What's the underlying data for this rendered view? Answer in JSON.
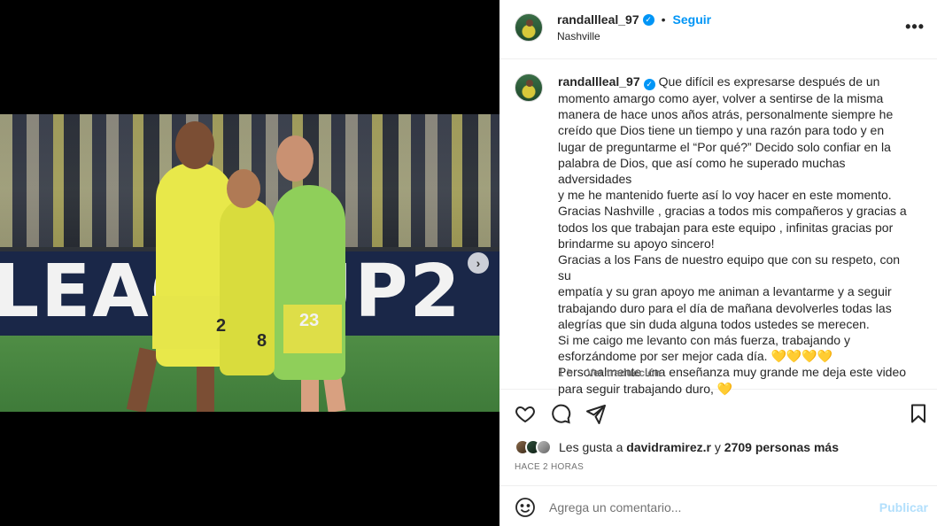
{
  "media": {
    "board_text": "LEAG  CUP2",
    "jersey_numbers": [
      "2",
      "8",
      "23"
    ],
    "next_glyph": "›",
    "carousel": {
      "count": 2,
      "active": 0
    }
  },
  "header": {
    "username": "randallleal_97",
    "verified_glyph": "✓",
    "separator": "•",
    "follow_label": "Seguir",
    "location": "Nashville",
    "more_glyph": "•••"
  },
  "caption": {
    "username": "randallleal_97",
    "lines": [
      "Que difícil es expresarse después de un",
      "momento amargo como ayer, volver a sentirse de la misma",
      "manera de hace unos años atrás, personalmente siempre he",
      "creído que Dios tiene un tiempo y una razón para todo y en",
      "lugar de preguntarme el “Por qué?” Decido solo confiar en la",
      "palabra de Dios, que así como he superado muchas adversidades",
      "y me he mantenido fuerte así lo voy hacer en este momento.",
      "Gracias Nashville , gracias a todos mis compañeros y gracias a",
      "todos los que trabajan para este equipo , infinitas gracias por",
      "brindarme su apoyo sincero!",
      "Gracias a los Fans de nuestro equipo que con su respeto, con su",
      "empatía y su gran apoyo me animan a levantarme y a seguir",
      "trabajando duro para el día de mañana devolverles todas las",
      "alegrías que sin duda alguna todos ustedes se merecen.",
      "Si me caigo me levanto con más fuerza, trabajando y",
      "esforzándome por ser mejor cada día. 💛💛💛💛",
      "Personalmente una enseñanza muy grande me deja este video",
      "para seguir trabajando duro, 💛"
    ],
    "age": "1 h",
    "translate_label": "Ver traducción"
  },
  "actions": {
    "like": "heart-icon",
    "comment": "comment-icon",
    "share": "share-icon",
    "save": "bookmark-icon"
  },
  "likes": {
    "prefix": "Les gusta a",
    "user": "davidramirez.r",
    "connector": "y",
    "others": "2709 personas más"
  },
  "timestamp": "HACE 2 HORAS",
  "comment": {
    "placeholder": "Agrega un comentario...",
    "publish_label": "Publicar"
  },
  "colors": {
    "accent": "#0095f6",
    "publish_disabled": "#b2dffc",
    "secondary_text": "#737373"
  }
}
